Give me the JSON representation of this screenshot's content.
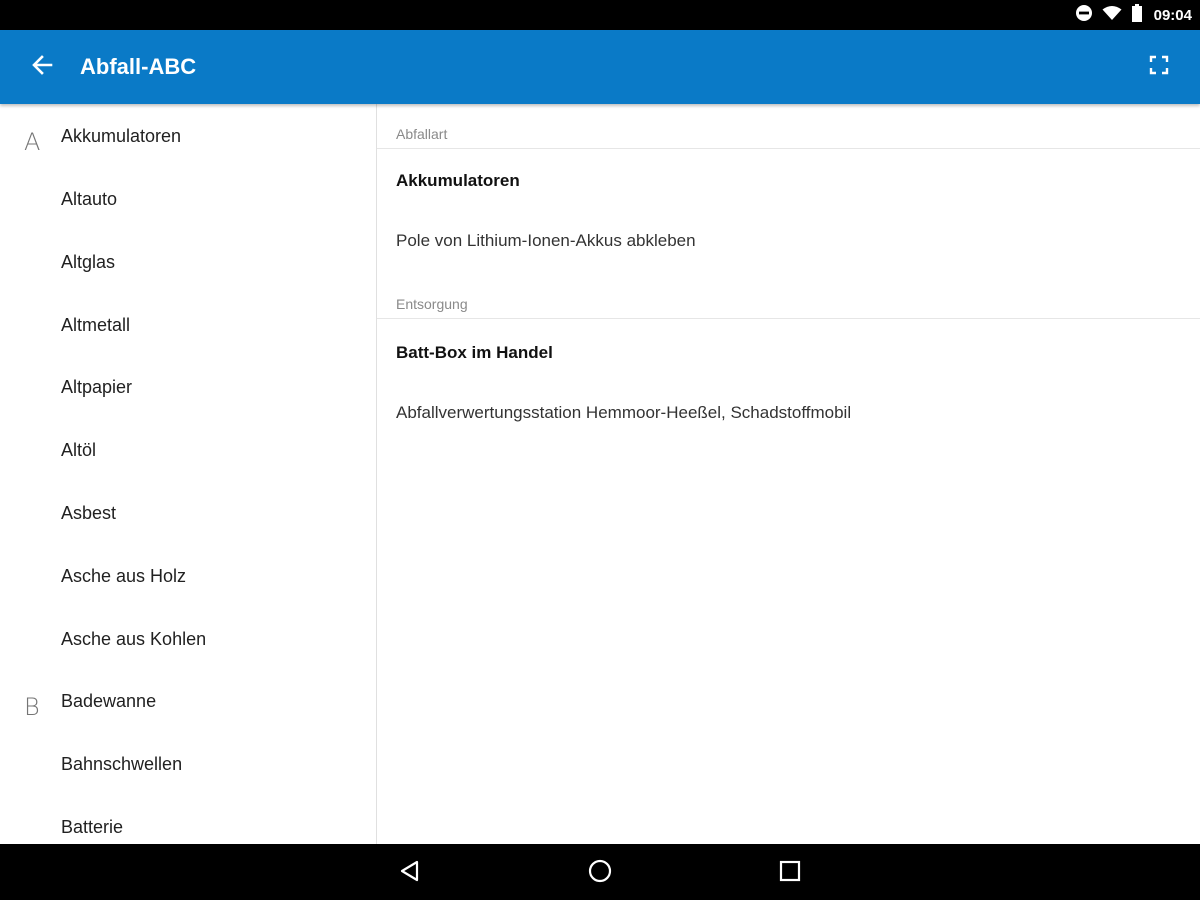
{
  "status_bar": {
    "time": "09:04",
    "icons": [
      "do-not-disturb-icon",
      "wifi-icon",
      "battery-icon"
    ]
  },
  "app_bar": {
    "title": "Abfall-ABC",
    "back_icon": "arrow-back-icon",
    "fullscreen_icon": "fullscreen-icon",
    "color": "#0a7ac7"
  },
  "list": {
    "items": [
      {
        "letter": "A",
        "label": "Akkumulatoren"
      },
      {
        "letter": "",
        "label": "Altauto"
      },
      {
        "letter": "",
        "label": "Altglas"
      },
      {
        "letter": "",
        "label": "Altmetall"
      },
      {
        "letter": "",
        "label": "Altpapier"
      },
      {
        "letter": "",
        "label": "Altöl"
      },
      {
        "letter": "",
        "label": "Asbest"
      },
      {
        "letter": "",
        "label": "Asche aus Holz"
      },
      {
        "letter": "",
        "label": "Asche aus Kohlen"
      },
      {
        "letter": "B",
        "label": "Badewanne"
      },
      {
        "letter": "",
        "label": "Bahnschwellen"
      },
      {
        "letter": "",
        "label": "Batterie"
      }
    ]
  },
  "detail": {
    "abfallart": {
      "header": "Abfallart",
      "title": "Akkumulatoren",
      "text": "Pole von Lithium-Ionen-Akkus abkleben"
    },
    "entsorgung": {
      "header": "Entsorgung",
      "title": "Batt-Box im Handel",
      "text": "Abfallverwertungsstation Hemmoor-Heeßel, Schadstoffmobil"
    }
  },
  "nav_bar": {
    "icons": [
      "back-triangle-icon",
      "home-circle-icon",
      "recents-square-icon"
    ]
  }
}
